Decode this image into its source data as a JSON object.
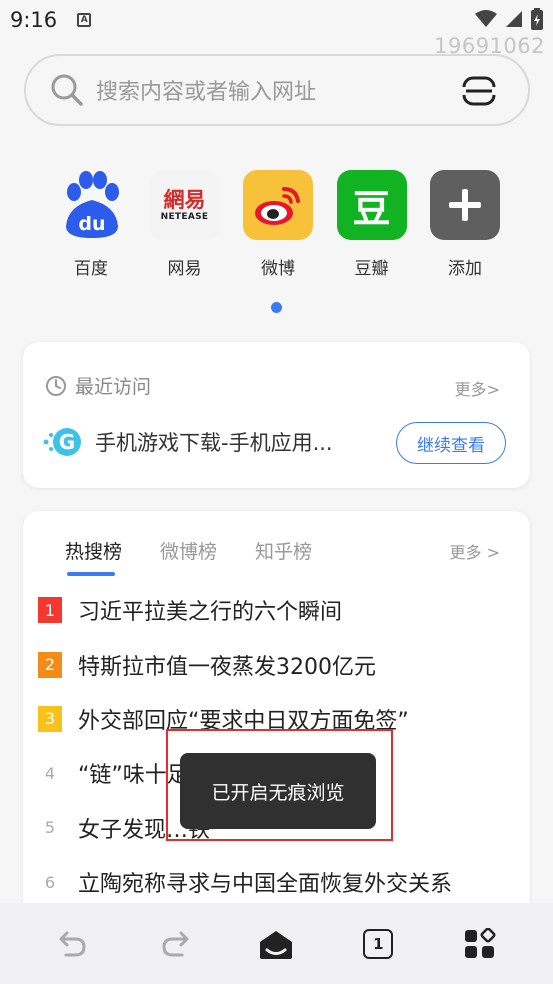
{
  "status": {
    "time": "9:16",
    "notification_glyph": "A",
    "watermark": "19691062"
  },
  "search": {
    "placeholder": "搜索内容或者输入网址"
  },
  "shortcuts": [
    {
      "label": "百度",
      "icon": "baidu-icon",
      "color": "#2d5bea"
    },
    {
      "label": "网易",
      "icon": "netease-icon",
      "color": "#f4f4f4"
    },
    {
      "label": "微博",
      "icon": "weibo-icon",
      "color": "#f7c23a"
    },
    {
      "label": "豆瓣",
      "icon": "douban-icon",
      "color": "#12b323"
    },
    {
      "label": "添加",
      "icon": "add-icon",
      "color": "#5f5f5f"
    }
  ],
  "netease_logo": {
    "chars": "網易",
    "sub": "NETEASE"
  },
  "douban_logo": {
    "char": "豆"
  },
  "recent": {
    "title": "最近访问",
    "more": "更多>",
    "item_text": "手机游戏下载-手机应用...",
    "continue_label": "继续查看"
  },
  "hot": {
    "tabs": [
      "热搜榜",
      "微博榜",
      "知乎榜"
    ],
    "more": "更多 >",
    "items": [
      {
        "rank": "1",
        "text": "习近平拉美之行的六个瞬间",
        "color": "#f2382f"
      },
      {
        "rank": "2",
        "text": "特斯拉市值一夜蒸发3200亿元",
        "color": "#f48b17"
      },
      {
        "rank": "3",
        "text": "外交部回应“要求中日双方面免签”",
        "color": "#f6c21b"
      },
      {
        "rank": "4",
        "text": "“链”味十足"
      },
      {
        "rank": "5",
        "text": "女子发现…铁”"
      },
      {
        "rank": "6",
        "text": "立陶宛称寻求与中国全面恢复外交关系"
      }
    ]
  },
  "toast": {
    "message": "已开启无痕浏览"
  },
  "bottom_nav": {
    "tab_count": "1"
  },
  "colors": {
    "accent": "#3a7bf2",
    "highlight": "#e52d2d",
    "toast_bg": "#303030"
  }
}
